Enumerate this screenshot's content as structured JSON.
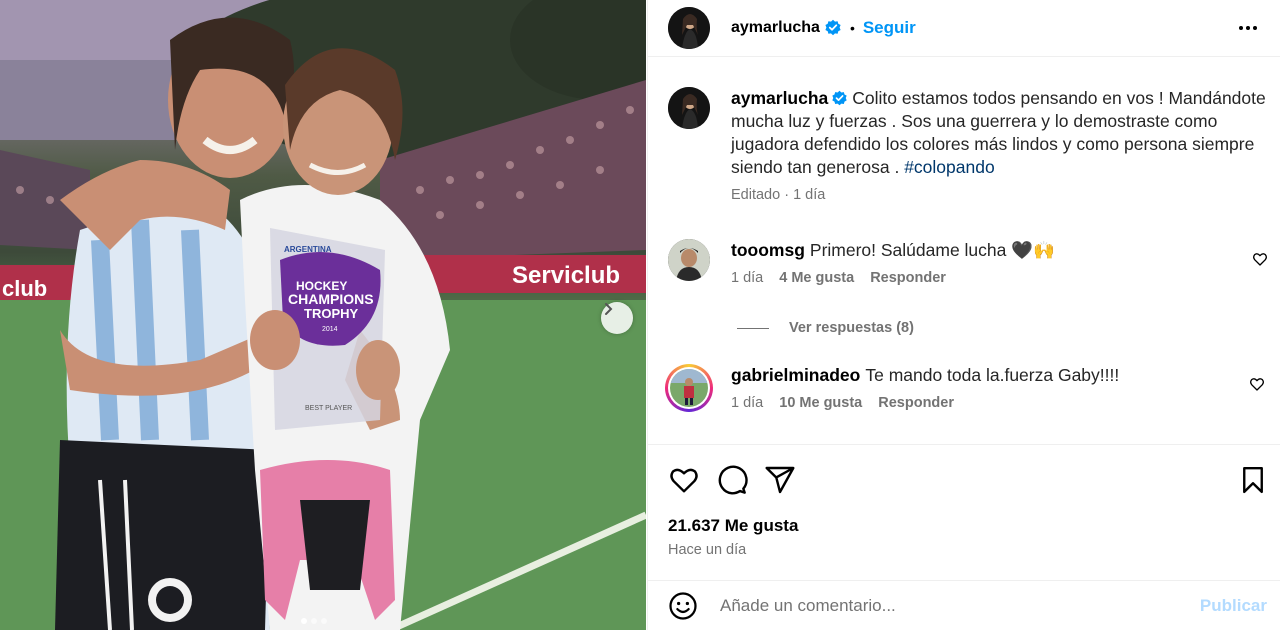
{
  "header": {
    "username": "aymarlucha",
    "separator": "•",
    "follow_label": "Seguir"
  },
  "caption": {
    "username": "aymarlucha",
    "text": "Colito estamos todos pensando en vos ! Mandándote mucha luz y fuerzas . Sos una guerrera y lo demostraste como jugadora defendido los colores más lindos y como persona siempre siendo tan generosa .",
    "hashtag": "#colopando",
    "meta": "Editado · 1 día"
  },
  "comments": [
    {
      "username": "tooomsg",
      "text": "Primero! Salúdame lucha 🖤🙌",
      "time": "1 día",
      "likes": "4 Me gusta",
      "reply_label": "Responder"
    },
    {
      "username": "gabrielminadeo",
      "text": "Te mando toda la.fuerza Gaby!!!!",
      "time": "1 día",
      "likes": "10 Me gusta",
      "reply_label": "Responder"
    }
  ],
  "view_replies": "Ver respuestas (8)",
  "likes_count": "21.637 Me gusta",
  "post_time": "Hace un día",
  "add_comment": {
    "placeholder": "Añade un comentario...",
    "publish_label": "Publicar"
  },
  "photo": {
    "banner_text": "Serviclub",
    "banner_left": "club",
    "trophy_line1": "HOCKEY",
    "trophy_line2": "CHAMPIONS",
    "trophy_line3": "TROPHY",
    "trophy_year": "2014",
    "trophy_top": "ARGENTINA",
    "trophy_bottom": "BEST PLAYER",
    "carousel_dots": 3,
    "active_dot": 0
  },
  "icons": {
    "more": "more-horizontal-icon",
    "verified": "verified-badge-icon",
    "like": "heart-icon",
    "comment": "comment-icon",
    "share": "share-icon",
    "save": "bookmark-icon",
    "emoji": "emoji-icon",
    "next": "chevron-right-icon"
  },
  "colors": {
    "accent": "#0095f6",
    "publish_disabled": "#b3dbff",
    "muted": "#737373"
  }
}
